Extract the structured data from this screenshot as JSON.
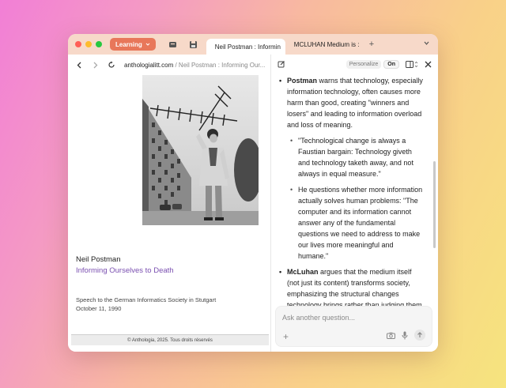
{
  "tabbar": {
    "workspace_label": "Learning",
    "tabs": [
      {
        "label": "Neil Postman : Informin",
        "active": true
      },
      {
        "label": "MCLUHAN Medium is :",
        "active": false
      }
    ],
    "colors": {
      "close": "#ff5f57",
      "minimize": "#febc2e",
      "maximize": "#28c840",
      "workspace": "#e8775a"
    }
  },
  "browser": {
    "url_host": "anthologialitt.com",
    "url_path": " / Neil Postman : Informing Our..."
  },
  "page": {
    "author": "Neil Postman",
    "title": "Informing Ourselves to Death",
    "speech_line": "Speech to the German Informatics Society in Stutgart",
    "date": "October 11, 1990",
    "footer": "© Anthologia, 2025. Tous droits réservés"
  },
  "assistant": {
    "personalize_label": "Personalize",
    "toggle_label": "On",
    "bullets": {
      "postman_name": "Postman",
      "postman_text": " warns that technology, especially information technology, often causes more harm than good, creating \"winners and losers\" and leading to information overload and loss of meaning.",
      "sub1": "\"Technological change is always a Faustian bargain: Technology giveth and technology taketh away, and not always in equal measure.\"",
      "sub2": "He questions whether more information actually solves human problems: \"The computer and its information cannot answer any of the fundamental questions we need to address to make our lives more meaningful and humane.\"",
      "mcluhan_name": "McLuhan",
      "mcluhan_text": " argues that the medium itself (not just its content) transforms society, emphasizing the structural changes technology brings rather than judging them as good or bad."
    },
    "ask_placeholder": "Ask another question..."
  }
}
